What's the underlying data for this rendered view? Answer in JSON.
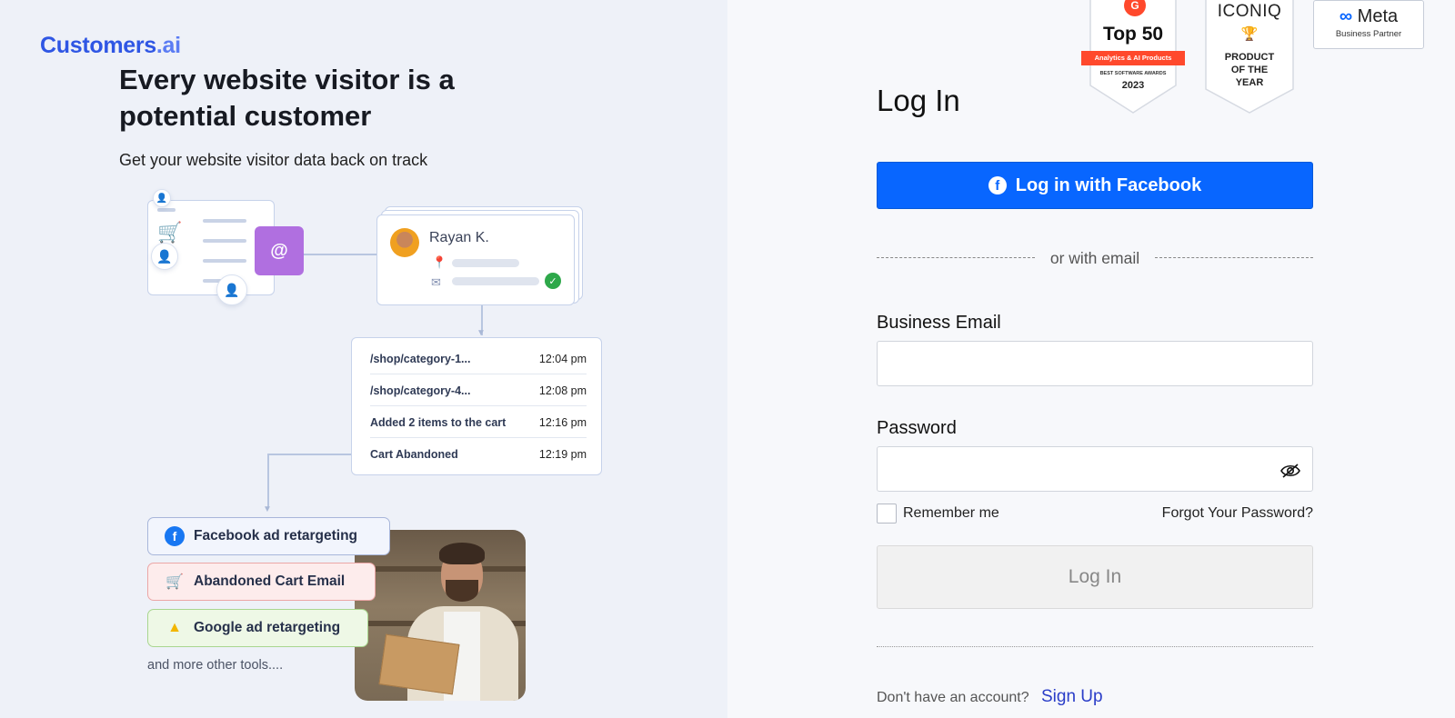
{
  "brand": {
    "name": "Customers",
    "suffix": ".ai",
    "color": "#2f56e4"
  },
  "hero": {
    "headline": "Every website visitor is a potential customer",
    "subline": "Get your website visitor data back on track"
  },
  "illustration": {
    "profile_name": "Rayan K.",
    "scan_symbol": "@",
    "events": [
      {
        "path": "/shop/category-1...",
        "time": "12:04 pm"
      },
      {
        "path": "/shop/category-4...",
        "time": "12:08 pm"
      },
      {
        "path": "Added  2 items to the cart",
        "time": "12:16 pm"
      },
      {
        "path": "Cart Abandoned",
        "time": "12:19 pm"
      }
    ],
    "tools": [
      {
        "label": "Facebook ad retargeting",
        "icon": "facebook-icon"
      },
      {
        "label": "Abandoned Cart Email",
        "icon": "cart-x-icon"
      },
      {
        "label": "Google ad retargeting",
        "icon": "google-ads-icon"
      }
    ],
    "more_text": "and more other tools...."
  },
  "badges": {
    "g2": {
      "logo": "G",
      "title": "Top 50",
      "ribbon": "Analytics & AI Products",
      "small": "BEST SOFTWARE AWARDS",
      "year": "2023"
    },
    "iconiq": {
      "title": "ICONIQ",
      "line1": "PRODUCT",
      "line2": "OF THE",
      "line3": "YEAR"
    },
    "meta": {
      "title": "Meta",
      "subtitle": "Business Partner"
    }
  },
  "login": {
    "title": "Log In",
    "facebook_button": "Log in with Facebook",
    "divider_text": "or with email",
    "email_label": "Business Email",
    "email_value": "",
    "password_label": "Password",
    "password_value": "",
    "remember_label": "Remember me",
    "forgot_link": "Forgot Your Password?",
    "submit_button": "Log In",
    "signup_question": "Don't have an account?",
    "signup_link": "Sign Up",
    "accent_color": "#0866ff"
  }
}
